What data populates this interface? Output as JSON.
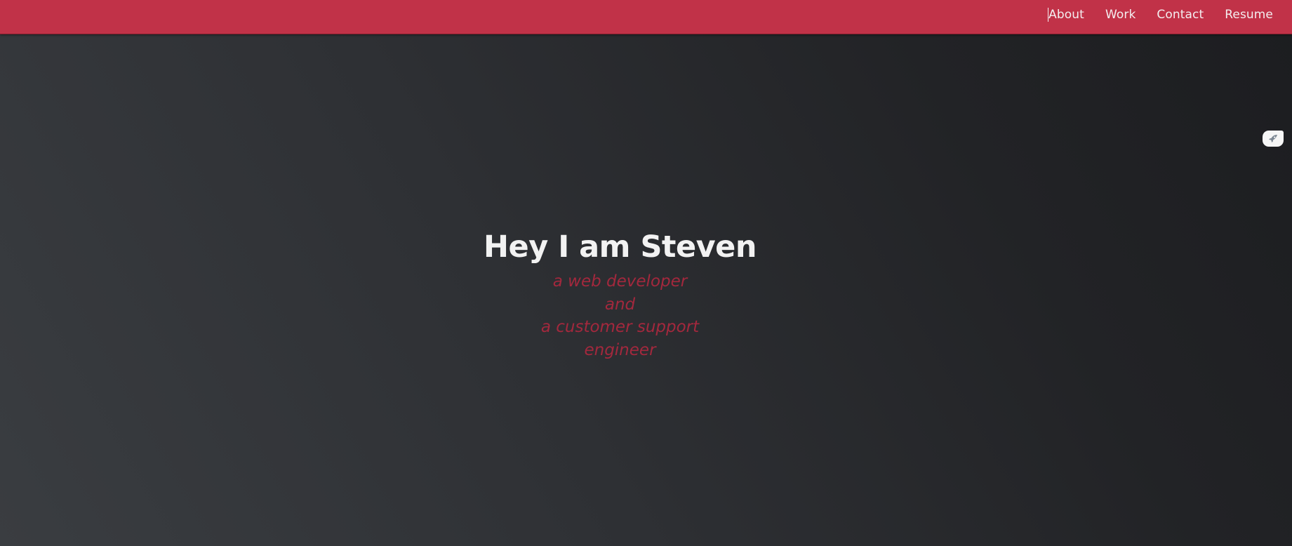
{
  "nav": {
    "items": [
      {
        "label": "About"
      },
      {
        "label": "Work"
      },
      {
        "label": "Contact"
      },
      {
        "label": "Resume"
      }
    ]
  },
  "hero": {
    "title": "Hey I am Steven",
    "subtitle_lines": [
      "a web developer",
      "and",
      "a customer support",
      "engineer"
    ]
  },
  "widget": {
    "icon": "rocket-icon"
  },
  "colors": {
    "nav_bg": "#c13248",
    "accent_text": "#a3283d",
    "title_text": "#f2f2f2",
    "bg_dark": "#1c1d20",
    "bg_light": "#3a3d41"
  }
}
